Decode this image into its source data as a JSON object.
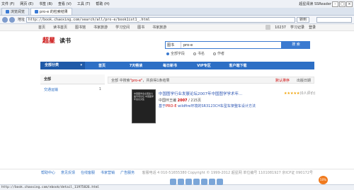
{
  "browser": {
    "menu": [
      "文件 (F)",
      "网页 (E)",
      "书签 (B)",
      "查看 (V)",
      "工具 (T)",
      "帮助 (H)"
    ],
    "brand": "超星阅读 SSReader",
    "tabs": [
      {
        "label": "浏览阅览"
      },
      {
        "label": "pro-e 的检索结果"
      }
    ],
    "address_label": "地址",
    "url": "http://book.chaoxing.com/search/all/pro-e/book1ist1_.html",
    "go_label": "转到",
    "status_url": "http://book.chaoxing.com/ebook/detail_11975826.html"
  },
  "sitenav": {
    "links": [
      "首页",
      "读书首页",
      "图书馆",
      "书家旅游",
      "学习空间",
      "图书",
      "书家旅游"
    ],
    "user": "10237",
    "right_links": [
      "学习记录",
      "登录"
    ]
  },
  "header": {
    "logo_mark": "超星",
    "logo_text": "读书",
    "search_scope": "图书",
    "search_query": "pro-e",
    "search_button": "搜 索",
    "radios": [
      "全部字段",
      "书名",
      "作者"
    ]
  },
  "channels": {
    "all_label": "全部分类",
    "items": [
      "首页",
      "7天畅读",
      "每日新书",
      "VIP专区",
      "客户端下载"
    ]
  },
  "sidebar": {
    "head": "全部",
    "items": [
      {
        "label": "交通运输",
        "count": "1"
      }
    ]
  },
  "results": {
    "crumb_prefix": "全部 中搜索",
    "crumb_query": "\"pro-e\"",
    "crumb_suffix": "，共获得1条结果",
    "sort": [
      "默认排序",
      "出版日期"
    ],
    "item": {
      "cover_text": "中国图学会全国第七届专项论坛 中国图学年会论文集",
      "title": "中国图学行业发展论坛2007年中国图学学术年...",
      "meta_prefix": "中国环王编",
      "meta_date": "2007",
      "meta_pages": "215页",
      "desc_prefix": "基于",
      "desc_hl": "PRO-E",
      "desc_suffix": "wildfire环境的SR3123CH车型车架整车设计方法",
      "rating_stars": "★★★★★",
      "rating_text": "(0人评价)"
    }
  },
  "footer": {
    "links": [
      "帮助中心",
      "意见反馈",
      "在线客服",
      "书家营销",
      "广告服务"
    ],
    "copyright": "客服电话 4 010-51655380 Copyright © 1999-2012 超星网 单位编号 1101081927 京ICP证 090172号",
    "fab_label": "50%"
  }
}
